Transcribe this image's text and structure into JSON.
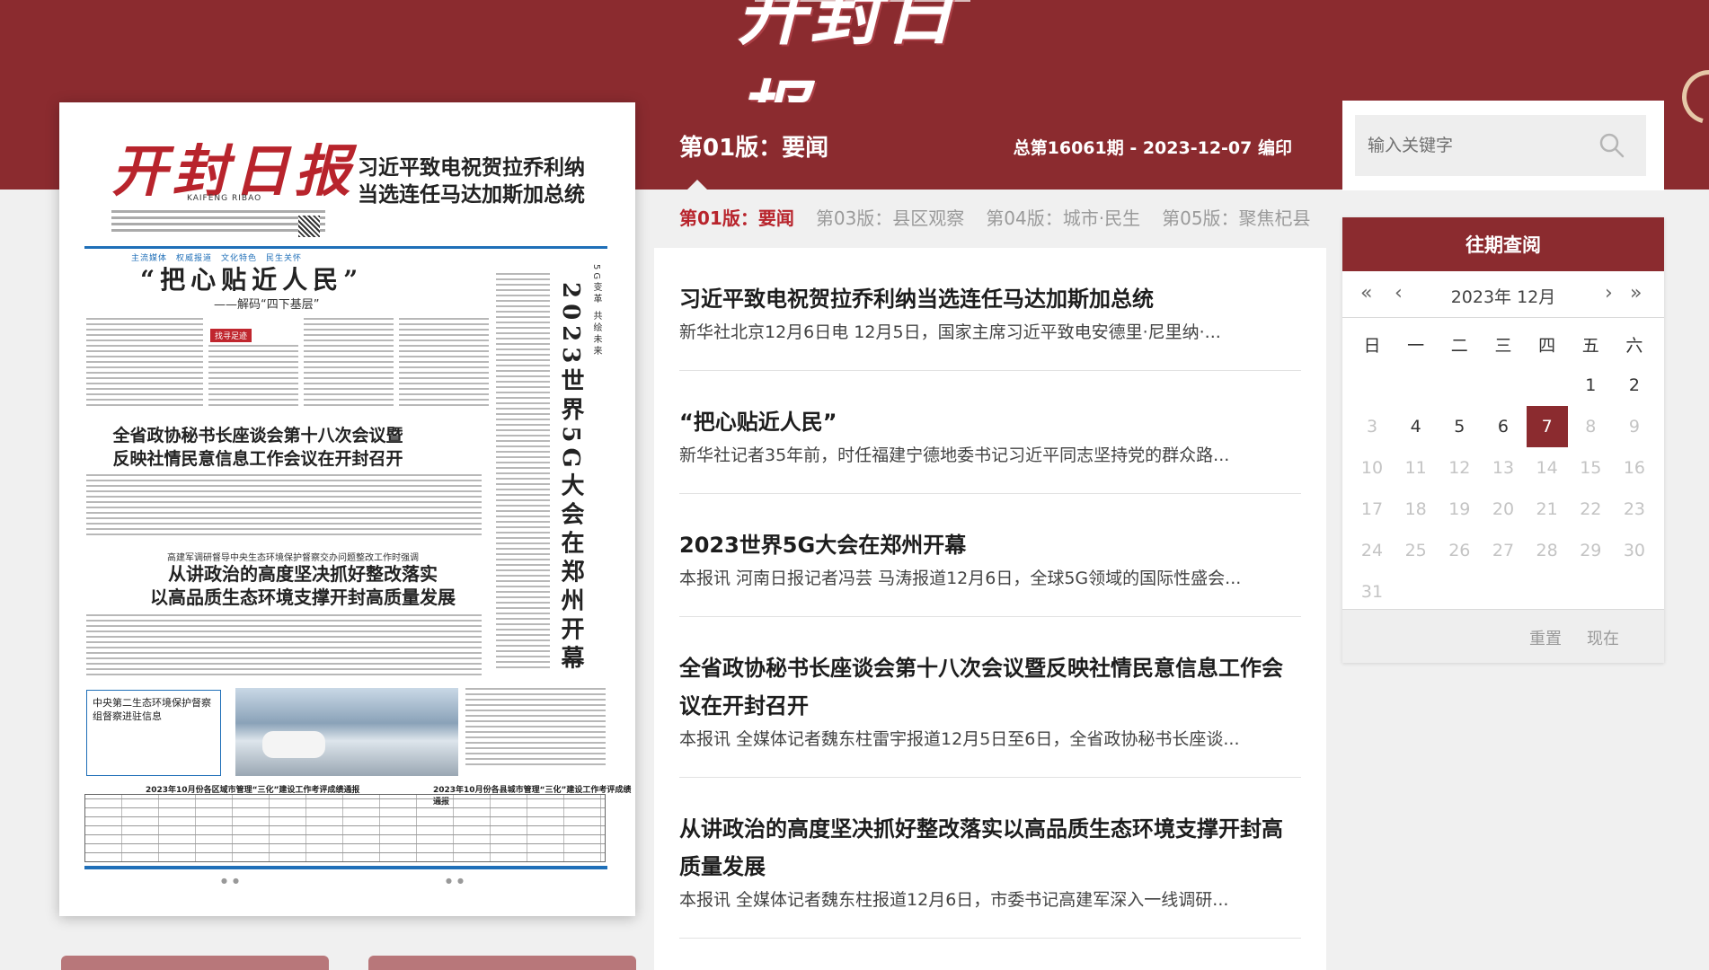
{
  "masthead": {
    "logo_text": "开封日报"
  },
  "paper": {
    "masthead": "开封日报",
    "masthead_en": "KAIFENG RIBAO",
    "headline_lines": [
      "习近平致电祝贺拉乔利纳",
      "当选连任马达加斯加总统"
    ],
    "sections": "主流媒体　权威报道　文化特色　民生关怀",
    "title2": "“把心贴近人民”",
    "subtitle2": "——解码“四下基层”",
    "vertical_headline": "2023世界5G大会在郑州开幕",
    "vertical_kicker": "5G变革 共绘未来",
    "tag": "找寻足迹",
    "title3_lines": [
      "全省政协秘书长座谈会第十八次会议暨",
      "反映社情民意信息工作会议在开封召开"
    ],
    "kicker4": "高建军调研督导中央生态环境保护督察交办问题整改工作时强调",
    "title4_lines": [
      "从讲政治的高度坚决抓好整改落实",
      "以高品质生态环境支撑开封高质量发展"
    ],
    "box_title": "中央第二生态环境保护督察组督察进驻信息",
    "table_title_left": "2023年10月份各区域市管理“三化”建设工作考评成绩通报",
    "table_title_right": "2023年10月份各县城市管理“三化”建设工作考评成绩通报"
  },
  "edition": {
    "title": "第01版：要闻",
    "info": "总第16061期 - 2023-12-07 编印"
  },
  "tabs": [
    {
      "label": "第01版：要闻",
      "active": true
    },
    {
      "label": "第03版：县区观察",
      "active": false
    },
    {
      "label": "第04版：城市·民生",
      "active": false
    },
    {
      "label": "第05版：聚焦杞县",
      "active": false
    }
  ],
  "articles": [
    {
      "title": "习近平致电祝贺拉乔利纳当选连任马达加斯加总统",
      "summary": "新华社北京12月6日电 12月5日，国家主席习近平致电安德里·尼里纳·..."
    },
    {
      "title": "“把心贴近人民”",
      "summary": "新华社记者35年前，时任福建宁德地委书记习近平同志坚持党的群众路..."
    },
    {
      "title": "2023世界5G大会在郑州开幕",
      "summary": "本报讯 河南日报记者冯芸 马涛报道12月6日，全球5G领域的国际性盛会..."
    },
    {
      "title": "全省政协秘书长座谈会第十八次会议暨反映社情民意信息工作会议在开封召开",
      "summary": "本报讯 全媒体记者魏东柱雷宇报道12月5日至6日，全省政协秘书长座谈..."
    },
    {
      "title": "从讲政治的高度坚决抓好整改落实以高品质生态环境支撑开封高质量发展",
      "summary": "本报讯 全媒体记者魏东柱报道12月6日，市委书记高建军深入一线调研..."
    }
  ],
  "search": {
    "placeholder": "输入关键字"
  },
  "calendar": {
    "header": "往期查阅",
    "prev_year": "«",
    "prev_month": "‹",
    "next_month": "›",
    "next_year": "»",
    "month_label": "2023年 12月",
    "weekdays": [
      "日",
      "一",
      "二",
      "三",
      "四",
      "五",
      "六"
    ],
    "selected_day": 7,
    "available_days": [
      1,
      2,
      4,
      5,
      6,
      7
    ],
    "reset_label": "重置",
    "now_label": "现在"
  },
  "colors": {
    "brand": "#8b2b2f",
    "accent": "#b8242c"
  },
  "icons": {
    "search": "search-icon"
  }
}
